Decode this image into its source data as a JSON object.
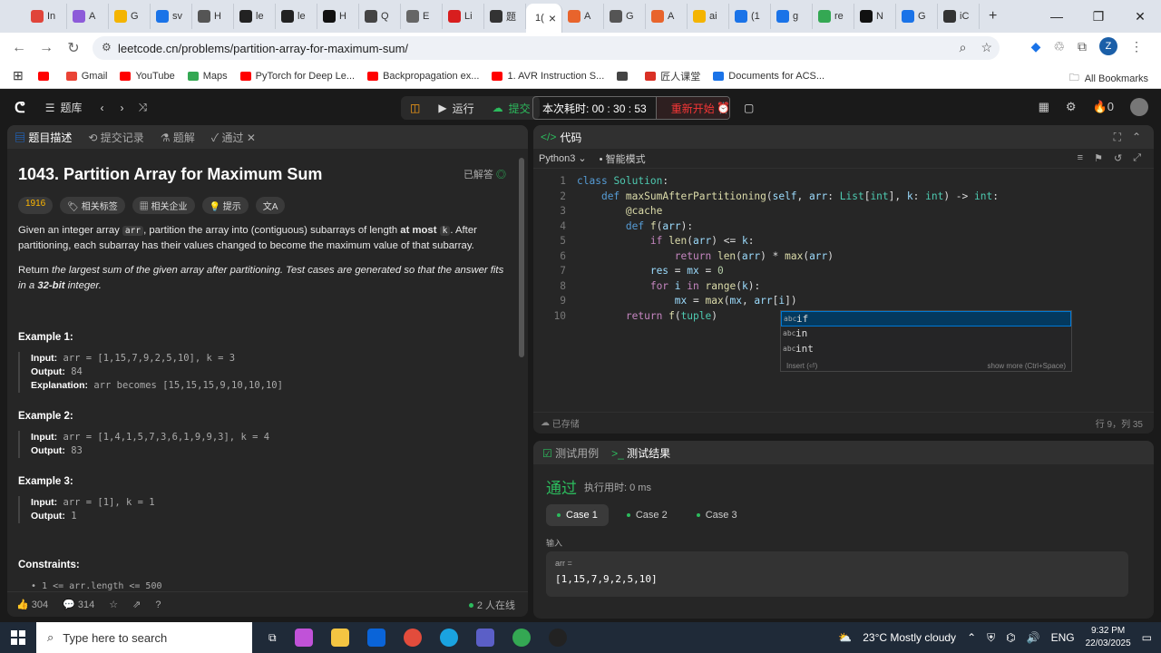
{
  "browser": {
    "tabs": [
      {
        "label": "In",
        "color": "#e0443a"
      },
      {
        "label": "A",
        "color": "#8d5bd9"
      },
      {
        "label": "G",
        "color": "#f4b400"
      },
      {
        "label": "sv",
        "color": "#1a73e8"
      },
      {
        "label": "H",
        "color": "#555555"
      },
      {
        "label": "le",
        "color": "#222222"
      },
      {
        "label": "le",
        "color": "#222222"
      },
      {
        "label": "H",
        "color": "#111111"
      },
      {
        "label": "Q",
        "color": "#444444"
      },
      {
        "label": "E",
        "color": "#666666"
      },
      {
        "label": "Li",
        "color": "#d81e1e"
      },
      {
        "label": "题",
        "color": "#333333"
      },
      {
        "label": "1(",
        "color": "#ffffff",
        "active": true
      },
      {
        "label": "A",
        "color": "#e8642c"
      },
      {
        "label": "G",
        "color": "#555555"
      },
      {
        "label": "A",
        "color": "#e8642c"
      },
      {
        "label": "ai",
        "color": "#f4b400"
      },
      {
        "label": "(1",
        "color": "#1a73e8"
      },
      {
        "label": "g",
        "color": "#1a73e8"
      },
      {
        "label": "re",
        "color": "#34a853"
      },
      {
        "label": "N",
        "color": "#111111"
      },
      {
        "label": "G",
        "color": "#1a73e8"
      },
      {
        "label": "iC",
        "color": "#333333"
      }
    ],
    "url": "leetcode.cn/problems/partition-array-for-maximum-sum/",
    "avatar_letter": "Z",
    "bookmarks": [
      {
        "label": "",
        "color": "#ff0000"
      },
      {
        "label": "Gmail",
        "color": "#ea4335"
      },
      {
        "label": "YouTube",
        "color": "#ff0000"
      },
      {
        "label": "Maps",
        "color": "#34a853"
      },
      {
        "label": "PyTorch for Deep Le...",
        "color": "#ff0000"
      },
      {
        "label": "Backpropagation ex...",
        "color": "#ff0000"
      },
      {
        "label": "1. AVR Instruction S...",
        "color": "#ff0000"
      },
      {
        "label": "",
        "color": "#444444"
      },
      {
        "label": "匠人课堂",
        "color": "#d93025"
      },
      {
        "label": "Documents for ACS...",
        "color": "#1a73e8"
      }
    ],
    "all_bookmarks": "All Bookmarks"
  },
  "lc": {
    "nav_label": "题库",
    "run_label": "运行",
    "submit_label": "提交",
    "timer_label": "本次耗时: 00 : 30 : 53",
    "restart_label": "重新开始",
    "streak": "0"
  },
  "left": {
    "tabs": [
      "题目描述",
      "提交记录",
      "题解",
      "通过"
    ],
    "title": "1043. Partition Array for Maximum Sum",
    "solved": "已解答",
    "tags": [
      "1916",
      "相关标签",
      "相关企业",
      "提示",
      "文A"
    ],
    "p1_a": "Given an integer array ",
    "p1_code1": "arr",
    "p1_b": ", partition the array into (contiguous) subarrays of length ",
    "p1_bold": "at most",
    "p1_code2": "k",
    "p1_c": ". After partitioning, each subarray has their values changed to become the maximum value of that subarray.",
    "p2_a": "Return ",
    "p2_i": "the largest sum of the given array after partitioning. Test cases are generated so that the answer fits in a ",
    "p2_bold": "32-bit",
    "p2_c": " integer.",
    "examples": [
      {
        "head": "Example 1:",
        "input": "arr = [1,15,7,9,2,5,10], k = 3",
        "output": "84",
        "explanation": "arr becomes [15,15,15,9,10,10,10]"
      },
      {
        "head": "Example 2:",
        "input": "arr = [1,4,1,5,7,3,6,1,9,9,3], k = 4",
        "output": "83"
      },
      {
        "head": "Example 3:",
        "input": "arr = [1], k = 1",
        "output": "1"
      }
    ],
    "input_label": "Input:",
    "output_label": "Output:",
    "explanation_label": "Explanation:",
    "constraints_head": "Constraints:",
    "constraint1": "1 <= arr.length <= 500",
    "likes": "304",
    "comments": "314",
    "online": "2 人在线"
  },
  "editor": {
    "title": "代码",
    "language": "Python3",
    "mode": "智能模式",
    "saved": "已存储",
    "cursor": "行 9，列 35",
    "suggestions": [
      "if",
      "in",
      "int"
    ],
    "suggest_hint_left": "Insert (⏎)",
    "suggest_hint_right": "show more (Ctrl+Space)"
  },
  "results": {
    "tabs": [
      "测试用例",
      "测试结果"
    ],
    "status": "通过",
    "runtime": "执行用时: 0 ms",
    "cases": [
      "Case 1",
      "Case 2",
      "Case 3"
    ],
    "input_label": "输入",
    "var": "arr =",
    "value": "[1,15,7,9,2,5,10]"
  },
  "taskbar": {
    "search_placeholder": "Type here to search",
    "weather": "23°C  Mostly cloudy",
    "lang": "ENG",
    "time": "9:32 PM",
    "date": "22/03/2025"
  }
}
